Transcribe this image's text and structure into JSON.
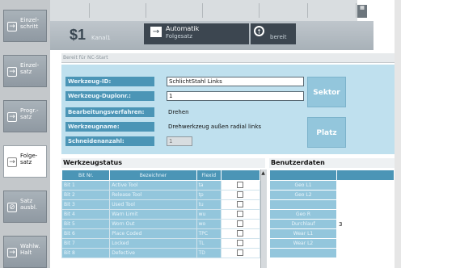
{
  "softkeys": [
    {
      "label": "Einzel-\nschritt",
      "icon": "arrow-right-icon",
      "active": false
    },
    {
      "label": "Einzel-\nsatz",
      "icon": "arrow-right-icon",
      "active": false
    },
    {
      "label": "Progr.-\nsatz",
      "icon": "arrow-right-icon",
      "active": false
    },
    {
      "label": "Folge-\nsatz",
      "icon": "arrow-right-icon",
      "active": true
    },
    {
      "label": "Satz\nausbl.",
      "icon": "skip-icon",
      "active": false
    },
    {
      "label": "Wahlw.\nHalt",
      "icon": "arrow-right-icon",
      "active": false
    }
  ],
  "status": {
    "step_number": "$1",
    "step_word": "Kanal1",
    "mode": "Automatik",
    "mode_sub": "Folgesatz",
    "state": "bereit",
    "message": "Bereit für NC-Start"
  },
  "form": {
    "fields": [
      {
        "label": "Werkzeug-ID:",
        "value": "SchlichtStahl Links",
        "kind": "input"
      },
      {
        "label": "Werkzeug-Duplonr.:",
        "value": "1",
        "kind": "input"
      },
      {
        "label": "Bearbeitungsverfahren:",
        "value": "Drehen",
        "kind": "text"
      },
      {
        "label": "Werkzeugname:",
        "value": "Drehwerkzeug außen radial links",
        "kind": "text"
      },
      {
        "label": "Schneidenanzahl:",
        "value": "1",
        "kind": "disabled"
      }
    ],
    "buttons": {
      "sektor": "Sektor",
      "platz": "Platz"
    }
  },
  "tool_status": {
    "title": "Werkzeugstatus",
    "columns": [
      "Bit Nr.",
      "Bezeichner",
      "Flexid",
      ""
    ],
    "rows": [
      {
        "bit": "Bit 1",
        "name": "Active Tool",
        "flex": "ta"
      },
      {
        "bit": "Bit 2",
        "name": "Release Tool",
        "flex": "tp"
      },
      {
        "bit": "Bit 3",
        "name": "Used Tool",
        "flex": "tu"
      },
      {
        "bit": "Bit 4",
        "name": "Warn Limit",
        "flex": "wu"
      },
      {
        "bit": "Bit 5",
        "name": "Worn Out",
        "flex": "wo"
      },
      {
        "bit": "Bit 6",
        "name": "Place Coded",
        "flex": "TPC"
      },
      {
        "bit": "Bit 7",
        "name": "Locked",
        "flex": "TL"
      },
      {
        "bit": "Bit 8",
        "name": "Defective",
        "flex": "TD"
      }
    ]
  },
  "user_data": {
    "title": "Benutzerdaten",
    "rows": [
      {
        "name": "Geo L1",
        "value": ""
      },
      {
        "name": "Geo L2",
        "value": ""
      },
      {
        "name": "",
        "value": ""
      },
      {
        "name": "Geo R",
        "value": ""
      },
      {
        "name": "Durchlauf",
        "value": "3"
      },
      {
        "name": "Wear L1",
        "value": ""
      },
      {
        "name": "Wear L2",
        "value": ""
      },
      {
        "name": "",
        "value": ""
      }
    ]
  },
  "top_segments": 6
}
